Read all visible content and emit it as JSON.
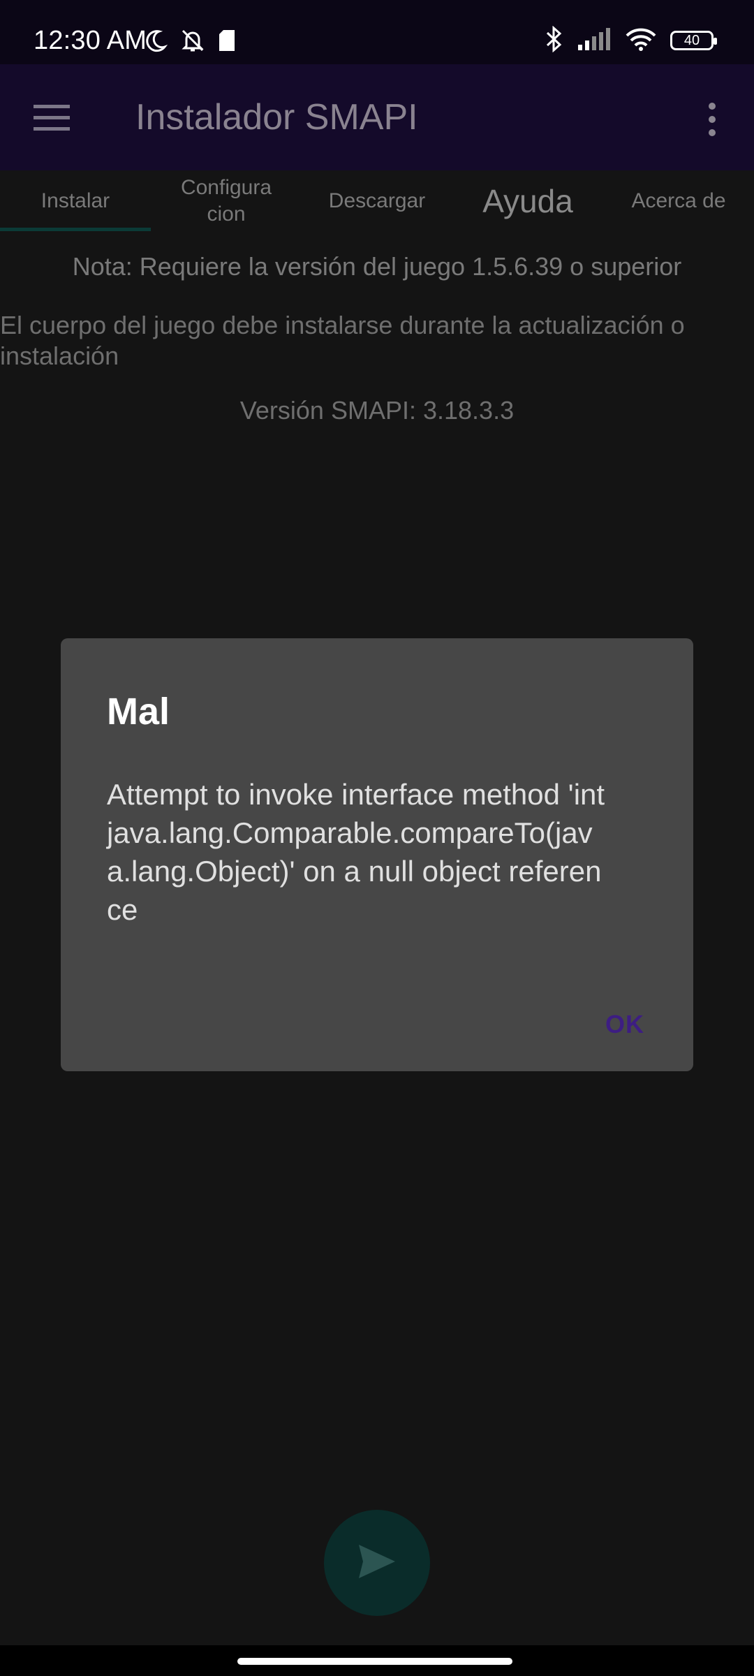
{
  "status_bar": {
    "time": "12:30 AM",
    "left_icons": [
      "moon-icon",
      "bell-off-icon",
      "sim-card-icon"
    ],
    "right_icons": [
      "bluetooth-icon",
      "signal-icon",
      "wifi-icon",
      "battery-icon"
    ],
    "battery_level": "40"
  },
  "app_bar": {
    "title": "Instalador SMAPI",
    "menu_icon": "hamburger-menu-icon",
    "overflow_icon": "more-vert-icon"
  },
  "tabs": [
    {
      "label": "Instalar",
      "selected": true
    },
    {
      "label": "Configura cion",
      "selected": false
    },
    {
      "label": "Descargar",
      "selected": false
    },
    {
      "label": "Ayuda",
      "selected": false
    },
    {
      "label": "Acerca de",
      "selected": false
    }
  ],
  "content": {
    "note": "Nota: Requiere la versión del juego 1.5.6.39 o superior",
    "body": "El cuerpo del juego debe instalarse durante la actualización o instalación",
    "version": "Versión SMAPI: 3.18.3.3"
  },
  "dialog": {
    "title": "Mal",
    "message": "Attempt to invoke interface method 'int java.lang.Comparable.compareTo(java.lang.Object)' on a null object reference",
    "ok_label": "OK"
  },
  "fab": {
    "icon": "send-icon"
  },
  "colors": {
    "app_bar": "#140a2a",
    "status_bar": "#0b0616",
    "background": "#141414",
    "dialog": "#474747",
    "accent": "#3d1d82",
    "fab": "#0a2c2a"
  }
}
